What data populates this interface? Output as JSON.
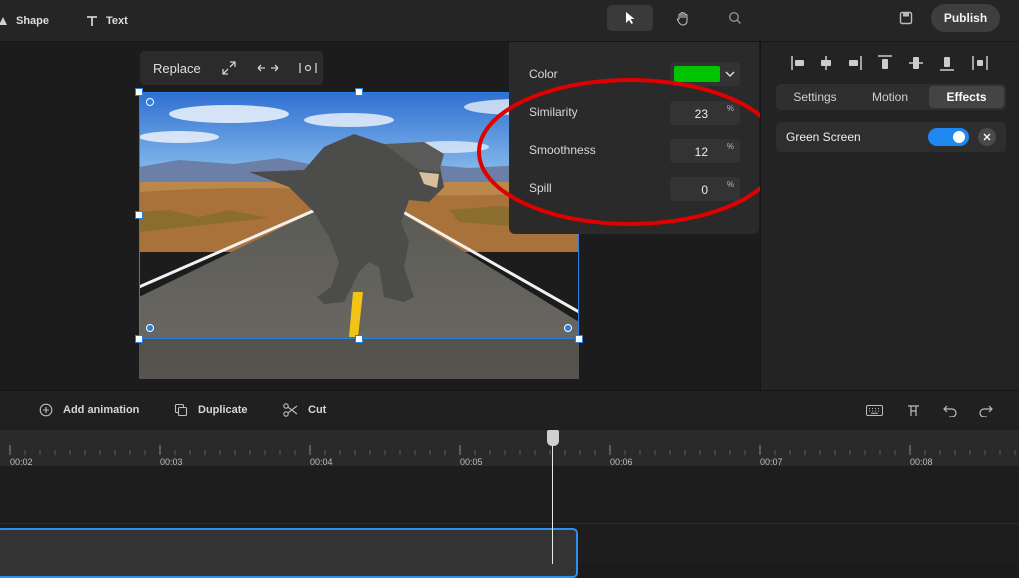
{
  "topbar": {
    "shape_label": "Shape",
    "text_label": "Text",
    "publish_label": "Publish"
  },
  "image_toolbar": {
    "replace_label": "Replace"
  },
  "green_screen_popover": {
    "color_label": "Color",
    "color_value": "#00c400",
    "similarity_label": "Similarity",
    "similarity_value": "23",
    "smoothness_label": "Smoothness",
    "smoothness_value": "12",
    "spill_label": "Spill",
    "spill_value": "0",
    "percent_unit": "%"
  },
  "right_panel": {
    "tabs": [
      "Settings",
      "Motion",
      "Effects"
    ],
    "active_tab": "Effects",
    "effect_name": "Green Screen",
    "effect_enabled": true
  },
  "bottom_toolbar": {
    "add_animation_label": "Add animation",
    "duplicate_label": "Duplicate",
    "cut_label": "Cut"
  },
  "timeline": {
    "ticks": [
      "00:02",
      "00:03",
      "00:04",
      "00:05",
      "00:06",
      "00:07",
      "00:08"
    ]
  },
  "colors": {
    "accent": "#2a7de1",
    "toggle_on": "#1e88f0",
    "annotation": "#e00000"
  }
}
